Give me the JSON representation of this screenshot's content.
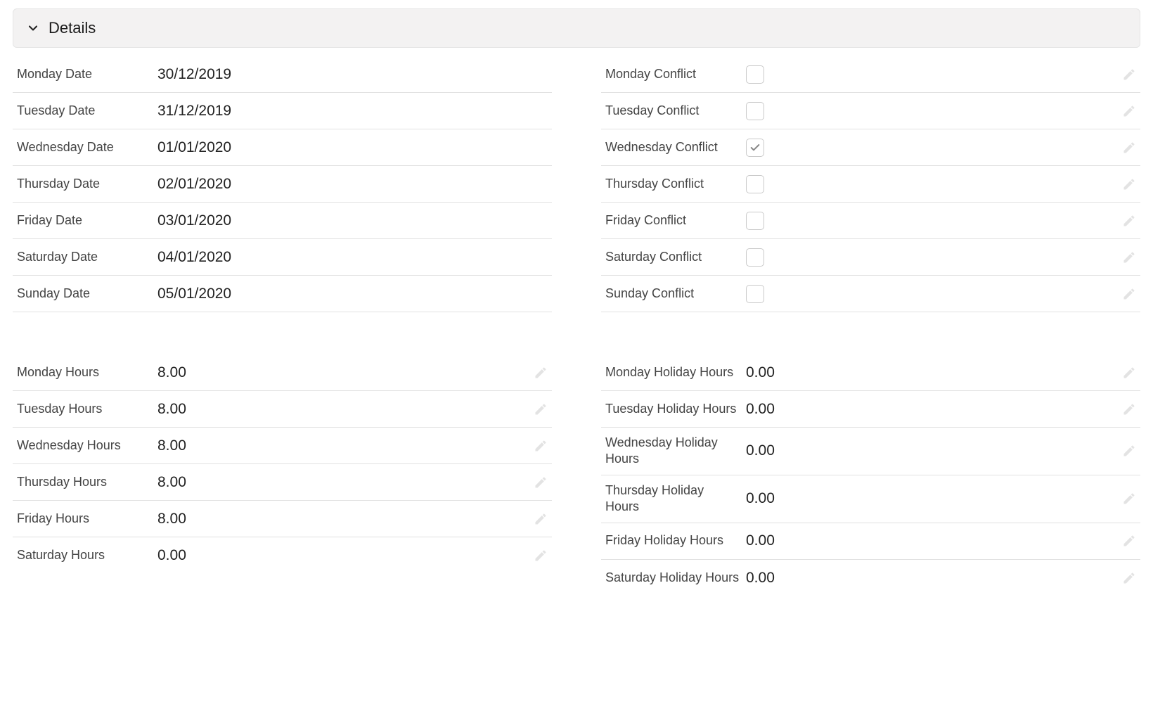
{
  "section": {
    "title": "Details"
  },
  "dates": {
    "monday": {
      "label": "Monday Date",
      "value": "30/12/2019"
    },
    "tuesday": {
      "label": "Tuesday Date",
      "value": "31/12/2019"
    },
    "wednesday": {
      "label": "Wednesday Date",
      "value": "01/01/2020"
    },
    "thursday": {
      "label": "Thursday Date",
      "value": "02/01/2020"
    },
    "friday": {
      "label": "Friday Date",
      "value": "03/01/2020"
    },
    "saturday": {
      "label": "Saturday Date",
      "value": "04/01/2020"
    },
    "sunday": {
      "label": "Sunday Date",
      "value": "05/01/2020"
    }
  },
  "conflicts": {
    "monday": {
      "label": "Monday Conflict",
      "checked": false
    },
    "tuesday": {
      "label": "Tuesday Conflict",
      "checked": false
    },
    "wednesday": {
      "label": "Wednesday Conflict",
      "checked": true
    },
    "thursday": {
      "label": "Thursday Conflict",
      "checked": false
    },
    "friday": {
      "label": "Friday Conflict",
      "checked": false
    },
    "saturday": {
      "label": "Saturday Conflict",
      "checked": false
    },
    "sunday": {
      "label": "Sunday Conflict",
      "checked": false
    }
  },
  "hours": {
    "monday": {
      "label": "Monday Hours",
      "value": "8.00"
    },
    "tuesday": {
      "label": "Tuesday Hours",
      "value": "8.00"
    },
    "wednesday": {
      "label": "Wednesday Hours",
      "value": "8.00"
    },
    "thursday": {
      "label": "Thursday Hours",
      "value": "8.00"
    },
    "friday": {
      "label": "Friday Hours",
      "value": "8.00"
    },
    "saturday": {
      "label": "Saturday Hours",
      "value": "0.00"
    }
  },
  "holiday": {
    "monday": {
      "label": "Monday Holiday Hours",
      "value": "0.00"
    },
    "tuesday": {
      "label": "Tuesday Holiday Hours",
      "value": "0.00"
    },
    "wednesday": {
      "label": "Wednesday Holi­day Hours",
      "value": "0.00"
    },
    "thursday": {
      "label": "Thursday Holiday Hours",
      "value": "0.00"
    },
    "friday": {
      "label": "Friday Holiday Hours",
      "value": "0.00"
    },
    "saturday": {
      "label": "Saturday Holiday Hours",
      "value": "0.00"
    }
  }
}
